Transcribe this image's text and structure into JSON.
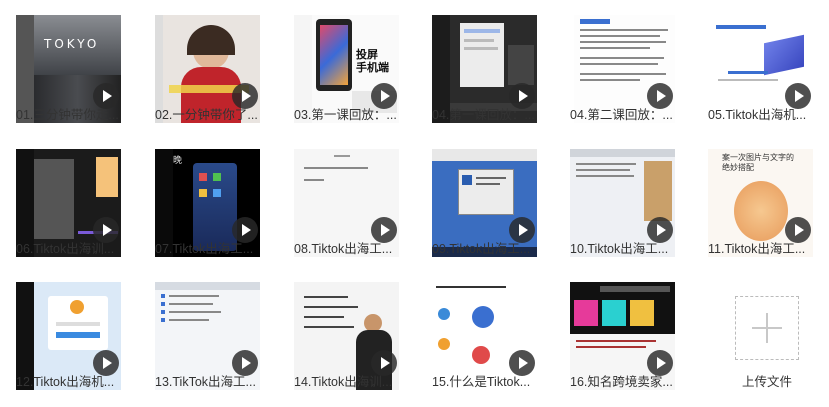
{
  "videos": [
    {
      "title": "01.三分钟带你走..."
    },
    {
      "title": "02.一分钟带你了..."
    },
    {
      "title": "03.第一课回放：..."
    },
    {
      "title": "04.第一课回放：..."
    },
    {
      "title": "04.第二课回放：..."
    },
    {
      "title": "05.Tiktok出海机..."
    },
    {
      "title": "06.Tiktok出海训..."
    },
    {
      "title": "07.Tiktok出海工..."
    },
    {
      "title": "08.Tiktok出海工..."
    },
    {
      "title": "09.Tiktok出海工..."
    },
    {
      "title": "10.Tiktok出海工..."
    },
    {
      "title": "11.Tiktok出海工..."
    },
    {
      "title": "12.Tiktok出海机..."
    },
    {
      "title": "13.TikTok出海工..."
    },
    {
      "title": "14.Tiktok出海训..."
    },
    {
      "title": "15.什么是Tiktok..."
    },
    {
      "title": "16.知名跨境卖家..."
    }
  ],
  "thumb_text": {
    "v1": "TOKYO",
    "v3": "投屏\n手机端",
    "v7": "晚",
    "v11": "案一次图片与文字的\n绝妙搭配"
  },
  "upload": {
    "label": "上传文件"
  }
}
